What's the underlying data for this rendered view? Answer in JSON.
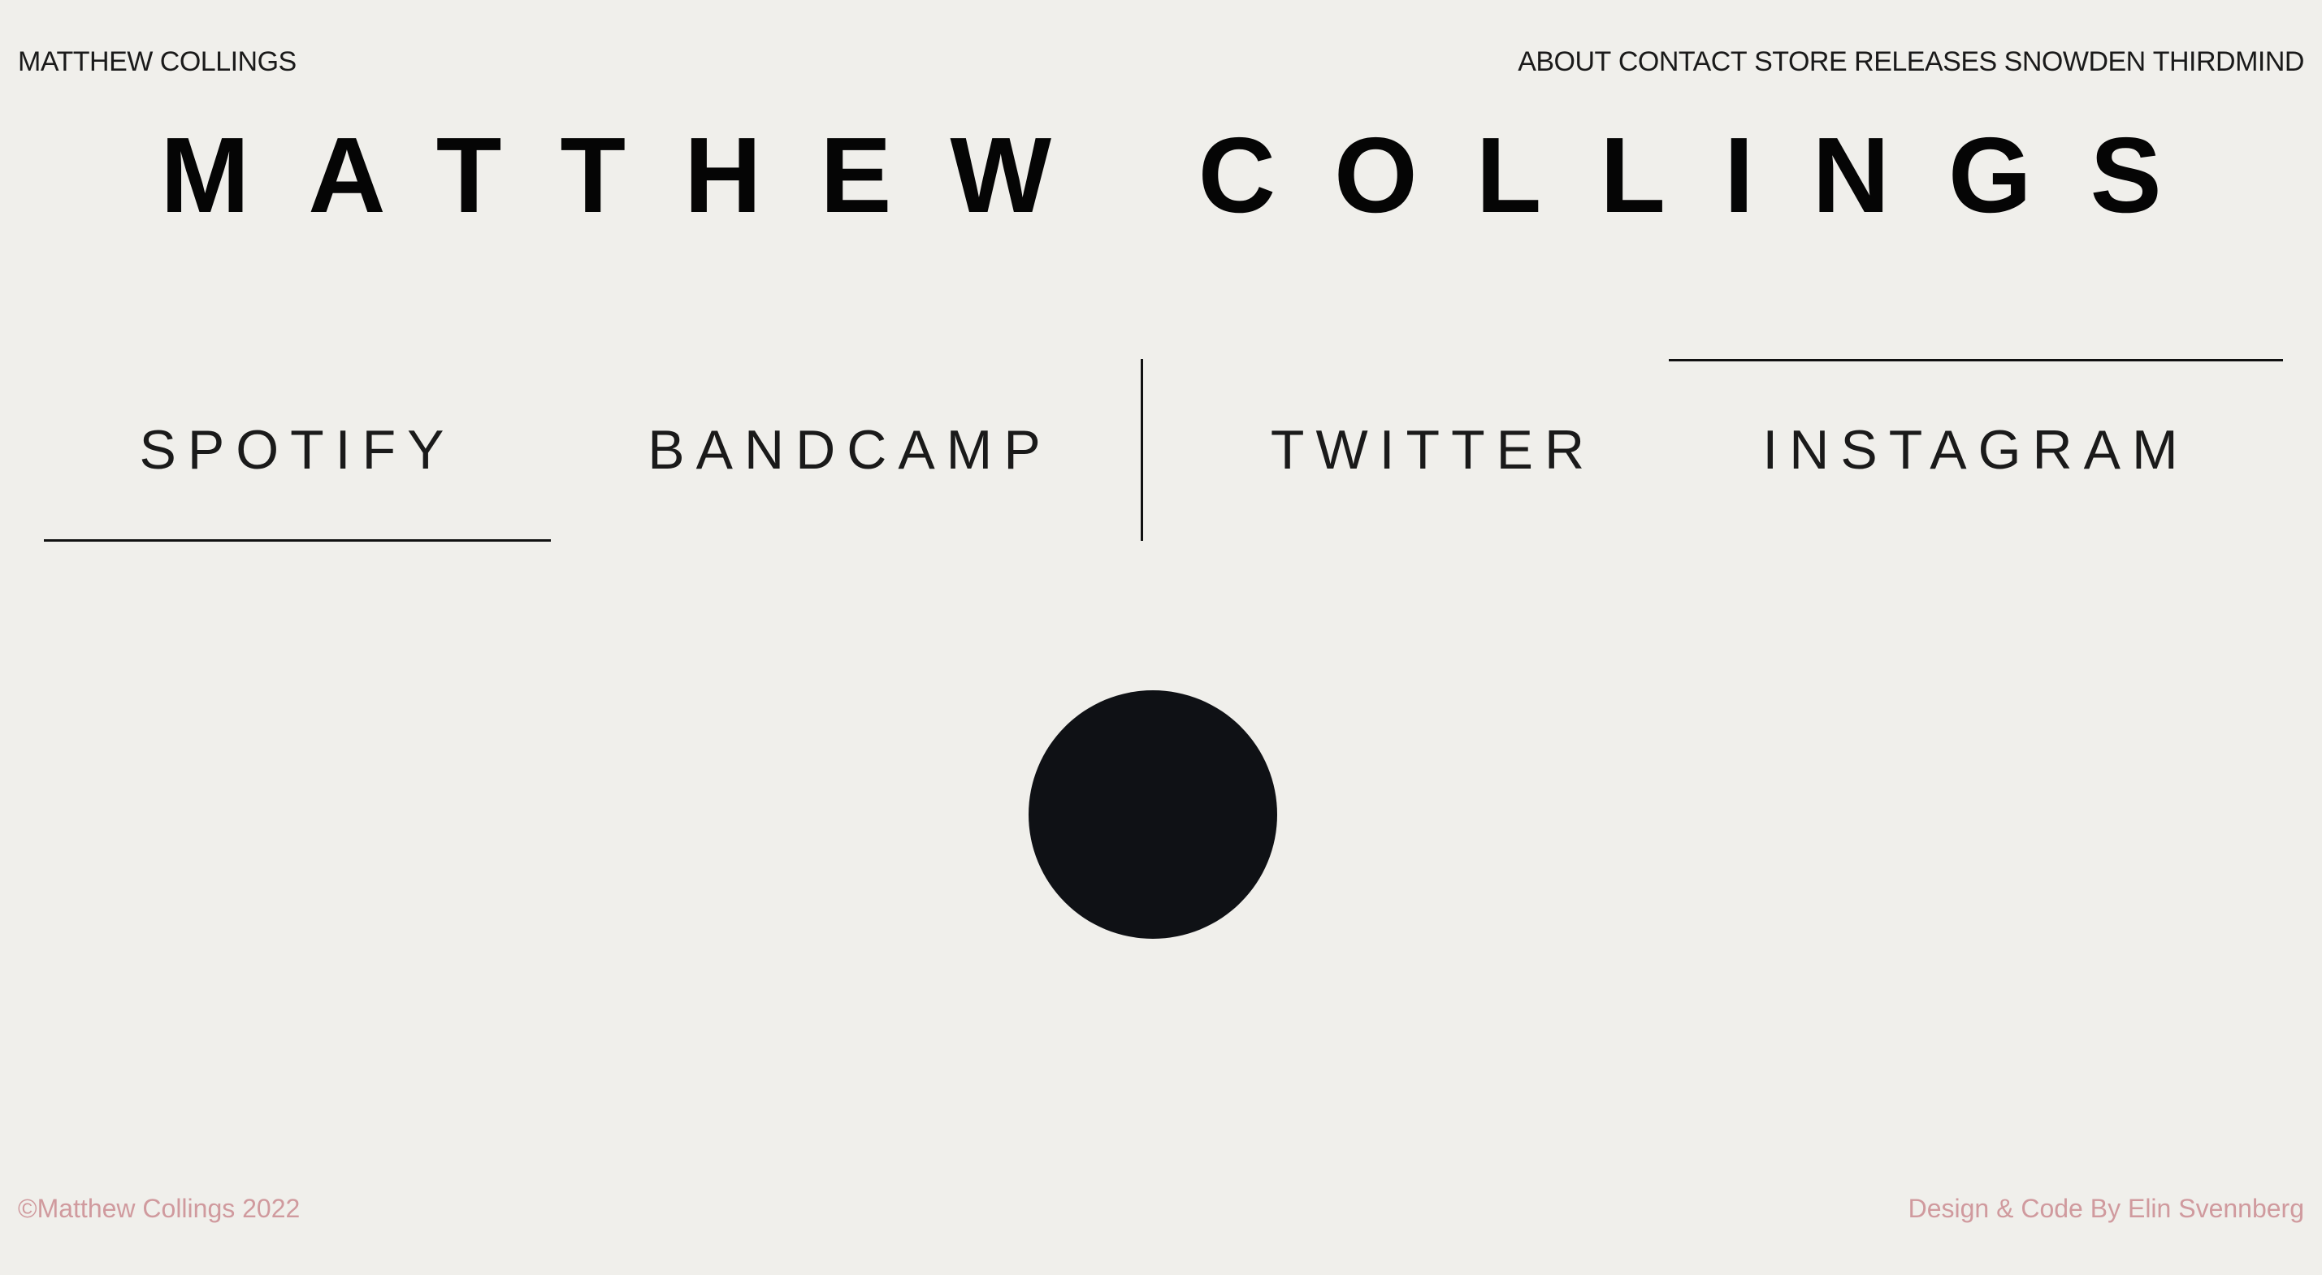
{
  "header": {
    "brand": "MATTHEW COLLINGS",
    "nav": [
      {
        "label": "ABOUT"
      },
      {
        "label": "CONTACT"
      },
      {
        "label": "STORE"
      },
      {
        "label": "RELEASES"
      },
      {
        "label": "SNOWDEN"
      },
      {
        "label": "THIRDMIND"
      }
    ]
  },
  "hero": {
    "title": "MATTHEW COLLINGS"
  },
  "social": {
    "spotify": "SPOTIFY",
    "bandcamp": "BANDCAMP",
    "twitter": "TWITTER",
    "instagram": "INSTAGRAM"
  },
  "footer": {
    "copyright": "©Matthew Collings 2022",
    "credit": "Design & Code By Elin Svennberg"
  },
  "colors": {
    "background": "#f0efeb",
    "text": "#111111",
    "footer_text": "#d09a9e",
    "dot": "#0f1115"
  }
}
